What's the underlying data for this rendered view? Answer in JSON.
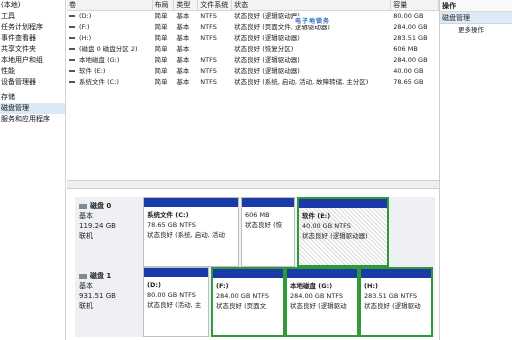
{
  "nav": {
    "items": [
      "(本地)",
      "工具",
      "任务计划程序",
      "事件查看器",
      "共享文件夹",
      "本地用户和组",
      "性能",
      "设备管理器"
    ],
    "storage_items": [
      "存储",
      "磁盘管理"
    ],
    "services_item": "服务和应用程序"
  },
  "table": {
    "headers": [
      "卷",
      "布局",
      "类型",
      "文件系统",
      "状态",
      "容量"
    ],
    "rows": [
      [
        "(D:)",
        "简单",
        "基本",
        "NTFS",
        "状态良好 (逻辑驱动器)",
        "80.00 GB"
      ],
      [
        "(F:)",
        "简单",
        "基本",
        "NTFS",
        "状态良好 (页面文件, 逻辑驱动器)",
        "284.00 GB"
      ],
      [
        "(H:)",
        "简单",
        "基本",
        "NTFS",
        "状态良好 (逻辑驱动器)",
        "283.51 GB"
      ],
      [
        "(磁盘 0 磁盘分区 2)",
        "简单",
        "基本",
        "",
        "状态良好 (恢复分区)",
        "606 MB"
      ],
      [
        "本地磁盘 (G:)",
        "简单",
        "基本",
        "NTFS",
        "状态良好 (逻辑驱动器)",
        "284.00 GB"
      ],
      [
        "软件 (E:)",
        "简单",
        "基本",
        "NTFS",
        "状态良好 (逻辑驱动器)",
        "40.00 GB"
      ],
      [
        "系统文件 (C:)",
        "简单",
        "基本",
        "NTFS",
        "状态良好 (系统, 启动, 活动, 故障转储, 主分区)",
        "78.65 GB"
      ]
    ]
  },
  "watermark": "电子地锁务",
  "disks": [
    {
      "name": "磁盘 0",
      "type": "基本",
      "size": "119.24 GB",
      "status": "联机",
      "partitions": [
        {
          "title": "系统文件 (C:)",
          "size": "78.65 GB NTFS",
          "status": "状态良好 (系统, 启动, 活动"
        },
        {
          "title": "",
          "size": "606 MB",
          "status": "状态良好 (恢"
        },
        {
          "title": "软件 (E:)",
          "size": "40.00 GB NTFS",
          "status": "状态良好 (逻辑驱动器)"
        }
      ]
    },
    {
      "name": "磁盘 1",
      "type": "基本",
      "size": "931.51 GB",
      "status": "联机",
      "partitions": [
        {
          "title": "(D:)",
          "size": "80.00 GB NTFS",
          "status": "状态良好 (活动, 主"
        },
        {
          "title": "(F:)",
          "size": "284.00 GB NTFS",
          "status": "状态良好 (页面文"
        },
        {
          "title": "本地磁盘 (G:)",
          "size": "284.00 GB NTFS",
          "status": "状态良好 (逻辑驱动"
        },
        {
          "title": "(H:)",
          "size": "283.51 GB NTFS",
          "status": "状态良好 (逻辑驱动"
        }
      ]
    }
  ],
  "actions": {
    "header": "操作",
    "section": "磁盘管理",
    "more": "更多操作"
  }
}
